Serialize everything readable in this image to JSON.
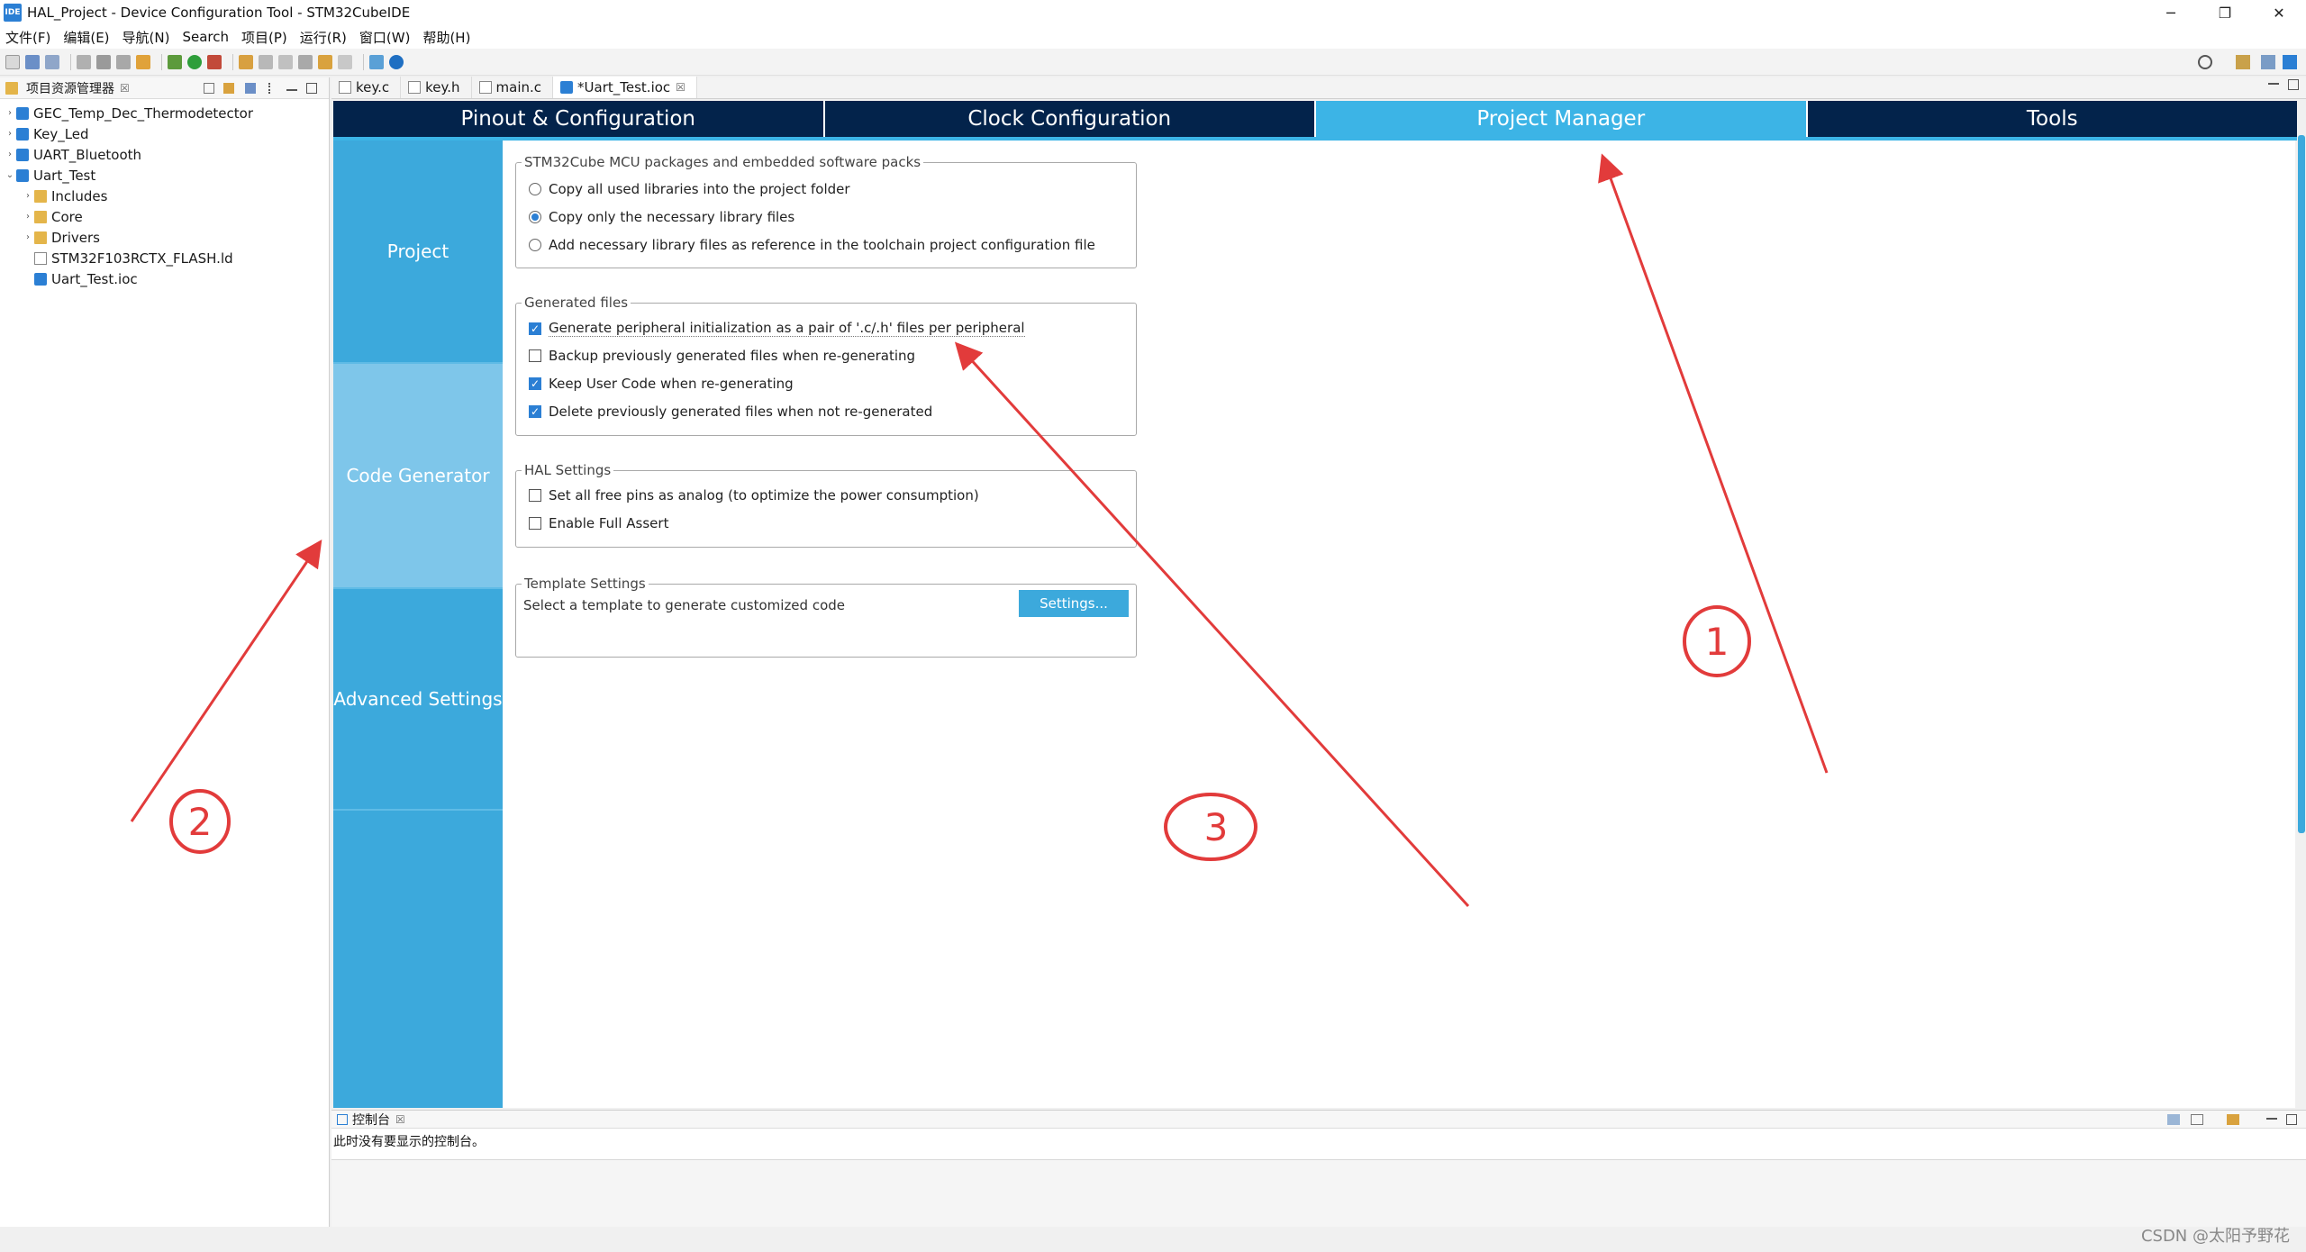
{
  "window": {
    "title": "HAL_Project - Device Configuration Tool - STM32CubeIDE",
    "app_icon_text": "IDE",
    "controls": {
      "minimize": "─",
      "restore": "❐",
      "close": "✕"
    }
  },
  "menu": [
    "文件(F)",
    "编辑(E)",
    "导航(N)",
    "Search",
    "项目(P)",
    "运行(R)",
    "窗口(W)",
    "帮助(H)"
  ],
  "explorer": {
    "title": "项目资源管理器",
    "close": "☒",
    "items": [
      {
        "label": "GEC_Temp_Dec_Thermodetector",
        "indent": 0,
        "chev": "›",
        "icon": "project"
      },
      {
        "label": "Key_Led",
        "indent": 0,
        "chev": "›",
        "icon": "project"
      },
      {
        "label": "UART_Bluetooth",
        "indent": 0,
        "chev": "›",
        "icon": "project"
      },
      {
        "label": "Uart_Test",
        "indent": 0,
        "chev": "⌄",
        "icon": "project"
      },
      {
        "label": "Includes",
        "indent": 1,
        "chev": "›",
        "icon": "folder"
      },
      {
        "label": "Core",
        "indent": 1,
        "chev": "›",
        "icon": "folder"
      },
      {
        "label": "Drivers",
        "indent": 1,
        "chev": "›",
        "icon": "folder"
      },
      {
        "label": "STM32F103RCTX_FLASH.ld",
        "indent": 1,
        "chev": "",
        "icon": "file"
      },
      {
        "label": "Uart_Test.ioc",
        "indent": 1,
        "chev": "",
        "icon": "project"
      }
    ]
  },
  "editor_tabs": [
    {
      "label": "key.c",
      "active": false
    },
    {
      "label": "key.h",
      "active": false
    },
    {
      "label": "main.c",
      "active": false
    },
    {
      "label": "*Uart_Test.ioc",
      "active": true,
      "close": "☒"
    }
  ],
  "top_tabs": [
    {
      "label": "Pinout & Configuration",
      "active": false
    },
    {
      "label": "Clock Configuration",
      "active": false
    },
    {
      "label": "Project Manager",
      "active": true
    },
    {
      "label": "Tools",
      "active": false
    }
  ],
  "side_nav": [
    {
      "label": "Project",
      "active": false
    },
    {
      "label": "Code Generator",
      "active": true
    },
    {
      "label": "Advanced Settings",
      "active": false
    }
  ],
  "packages": {
    "legend": "STM32Cube MCU packages and embedded software packs",
    "options": [
      {
        "label": "Copy all used libraries into the project folder",
        "selected": false
      },
      {
        "label": "Copy only the necessary library files",
        "selected": true
      },
      {
        "label": "Add necessary library files as reference in the toolchain project configuration file",
        "selected": false
      }
    ]
  },
  "generated_files": {
    "legend": "Generated files",
    "options": [
      {
        "label": "Generate peripheral initialization as a pair of '.c/.h' files per peripheral",
        "checked": true
      },
      {
        "label": "Backup previously generated files when re-generating",
        "checked": false
      },
      {
        "label": "Keep User Code when re-generating",
        "checked": true
      },
      {
        "label": "Delete previously generated files when not re-generated",
        "checked": true
      }
    ]
  },
  "hal_settings": {
    "legend": "HAL Settings",
    "options": [
      {
        "label": "Set all free pins as analog (to optimize the power consumption)",
        "checked": false
      },
      {
        "label": "Enable Full Assert",
        "checked": false
      }
    ]
  },
  "template_settings": {
    "legend": "Template Settings",
    "description": "Select a template to generate customized code",
    "button": "Settings..."
  },
  "console": {
    "title": "控制台",
    "close": "☒",
    "message": "此时没有要显示的控制台。"
  },
  "annotations": {
    "one": "1",
    "two": "2",
    "three": "3"
  },
  "watermark": "CSDN @太阳予野花",
  "colors": {
    "nav_dark": "#03234b",
    "accent": "#3cb4e6",
    "side_nav": "#3ca9dc",
    "annotation_red": "#e23b3b"
  }
}
